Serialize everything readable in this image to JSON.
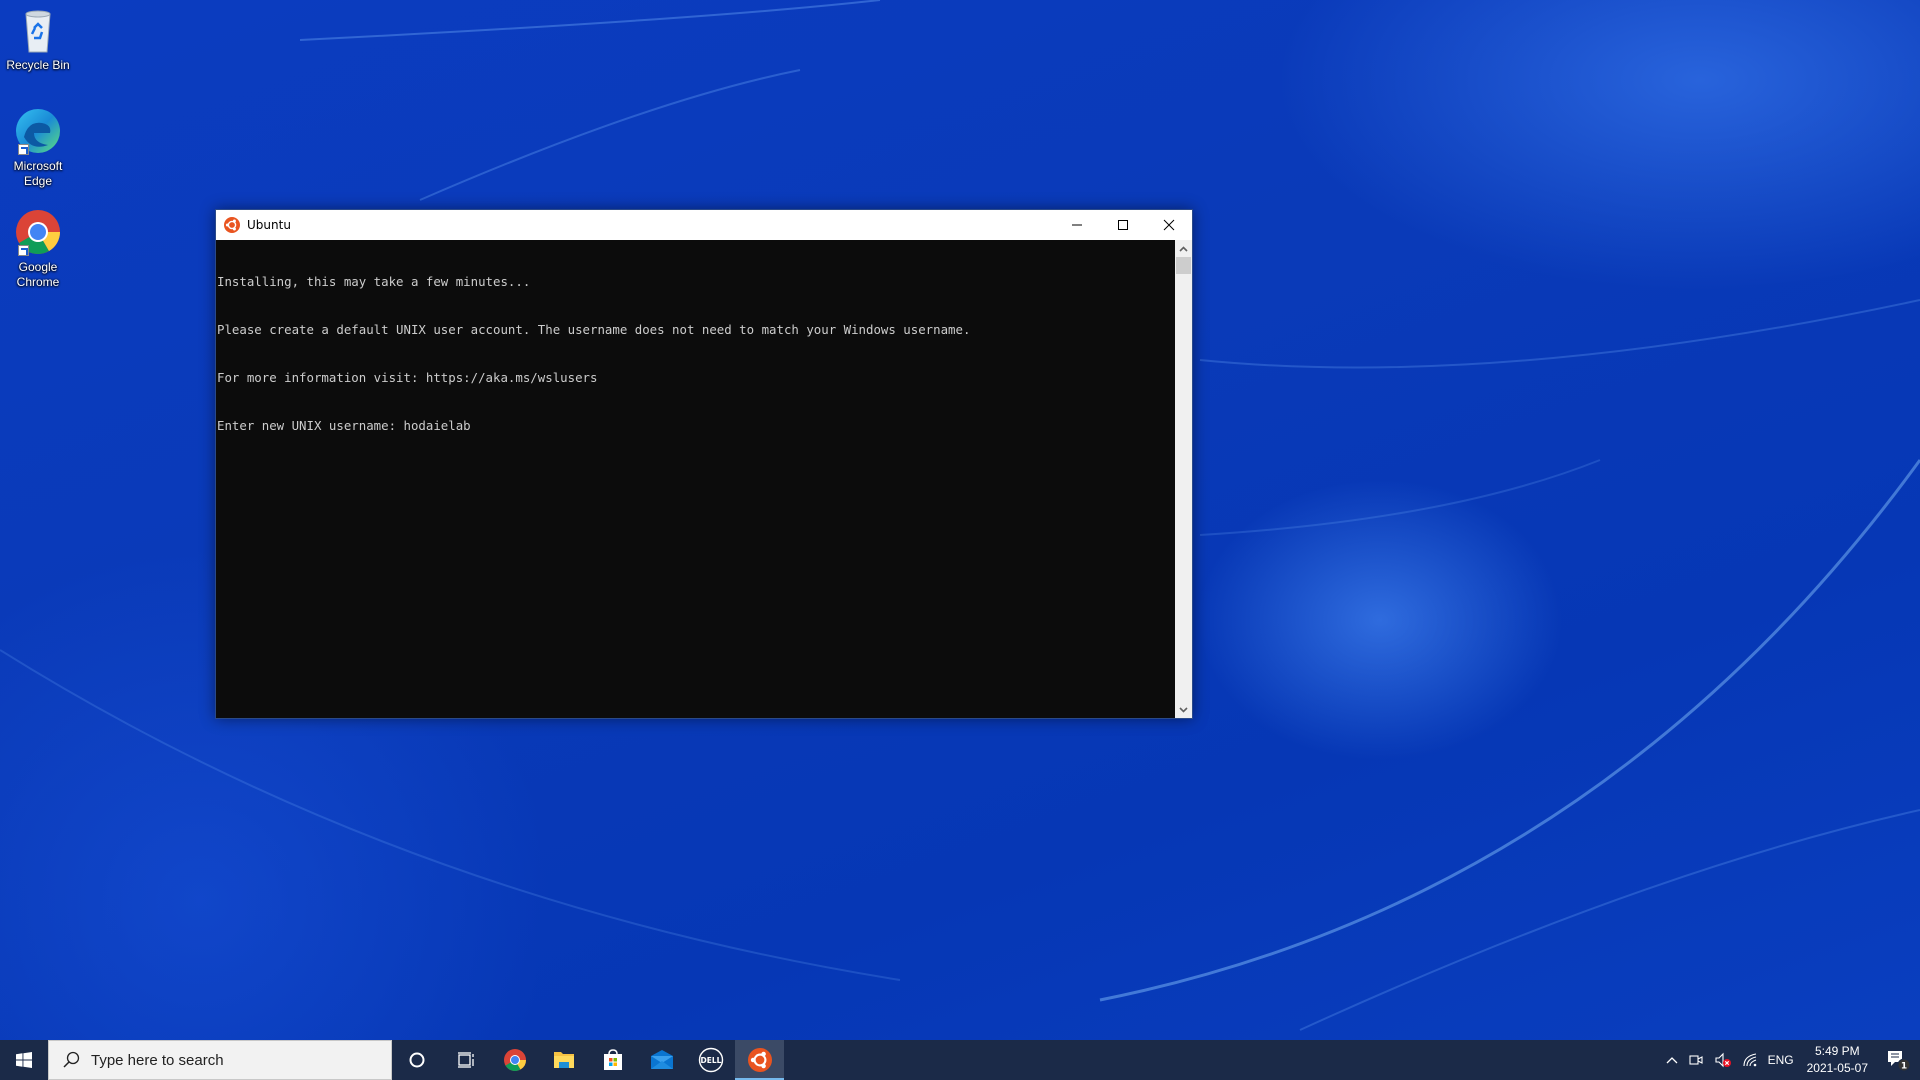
{
  "desktop": {
    "icons": [
      {
        "label_lines": [
          "Recycle Bin"
        ],
        "icon": "recycle-bin-icon"
      },
      {
        "label_lines": [
          "Microsoft",
          "Edge"
        ],
        "icon": "edge-icon"
      },
      {
        "label_lines": [
          "Google",
          "Chrome"
        ],
        "icon": "chrome-icon"
      }
    ]
  },
  "window": {
    "title": "Ubuntu",
    "icon": "ubuntu-icon",
    "controls": {
      "minimize": "minimize-icon",
      "maximize": "maximize-icon",
      "close": "close-icon"
    },
    "terminal_lines": [
      "Installing, this may take a few minutes...",
      "Please create a default UNIX user account. The username does not need to match your Windows username.",
      "For more information visit: https://aka.ms/wslusers",
      "Enter new UNIX username: hodaielab"
    ]
  },
  "taskbar": {
    "search_placeholder": "Type here to search",
    "pinned": [
      {
        "name": "cortana",
        "icon": "cortana-icon"
      },
      {
        "name": "task-view",
        "icon": "task-view-icon"
      },
      {
        "name": "chrome",
        "icon": "chrome-icon"
      },
      {
        "name": "file-explorer",
        "icon": "folder-icon"
      },
      {
        "name": "microsoft-store",
        "icon": "store-icon"
      },
      {
        "name": "mail",
        "icon": "mail-icon"
      },
      {
        "name": "dell",
        "icon": "dell-icon",
        "text": "DELL"
      },
      {
        "name": "ubuntu",
        "icon": "ubuntu-icon",
        "active": true
      }
    ],
    "tray": {
      "language": "ENG",
      "time": "5:49 PM",
      "date": "2021-05-07",
      "notification_count": "1"
    }
  },
  "colors": {
    "ubuntu_orange": "#e95420",
    "taskbar_bg": "#1b2a48",
    "terminal_bg": "#0c0c0c",
    "terminal_fg": "#cccccc"
  }
}
